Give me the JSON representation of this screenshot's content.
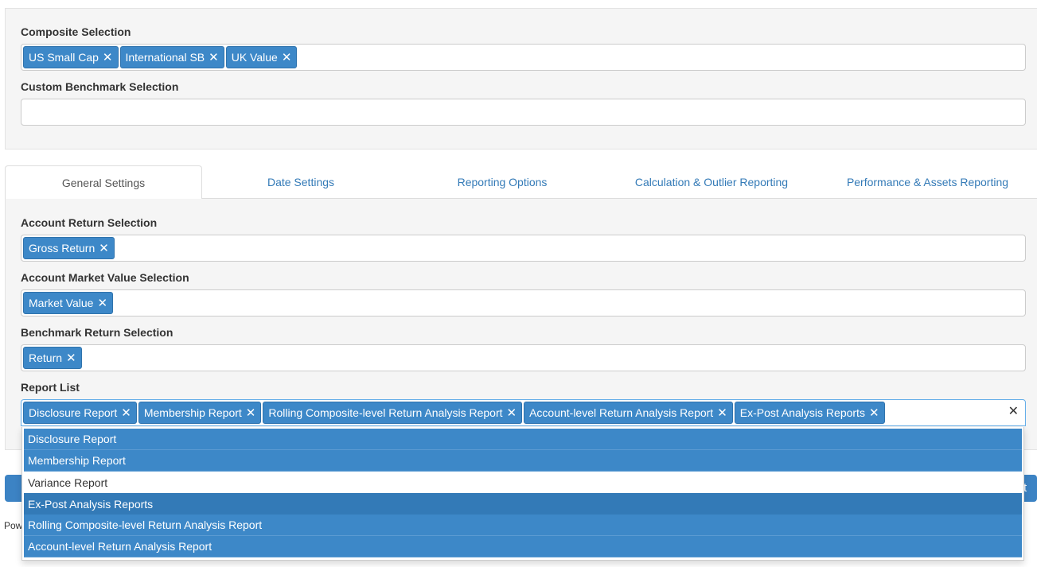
{
  "composite": {
    "label": "Composite Selection",
    "chips": [
      "US Small Cap",
      "International SB",
      "UK Value"
    ]
  },
  "custom_benchmark": {
    "label": "Custom Benchmark Selection"
  },
  "tabs": [
    {
      "label": "General Settings"
    },
    {
      "label": "Date Settings"
    },
    {
      "label": "Reporting Options"
    },
    {
      "label": "Calculation & Outlier Reporting"
    },
    {
      "label": "Performance & Assets Reporting"
    }
  ],
  "account_return": {
    "label": "Account Return Selection",
    "chips": [
      "Gross Return"
    ]
  },
  "account_market_value": {
    "label": "Account Market Value Selection",
    "chips": [
      "Market Value"
    ]
  },
  "benchmark_return": {
    "label": "Benchmark Return Selection",
    "chips": [
      "Return"
    ]
  },
  "report_list": {
    "label": "Report List",
    "chips": [
      "Disclosure Report",
      "Membership Report",
      "Rolling Composite-level Return Analysis Report",
      "Account-level Return Analysis Report",
      "Ex-Post Analysis Reports"
    ],
    "options": [
      "Disclosure Report",
      "Membership Report",
      "Variance Report",
      "Ex-Post Analysis Reports",
      "Rolling Composite-level Return Analysis Report",
      "Account-level Return Analysis Report"
    ]
  },
  "chip_remove_glyph": "✕",
  "clear_glyph": "✕",
  "bottom_button_tail": "t",
  "footer_text": "Pow",
  "colors": {
    "chip": "#3d88c8",
    "link": "#337ab7",
    "panel": "#f5f5f5"
  }
}
